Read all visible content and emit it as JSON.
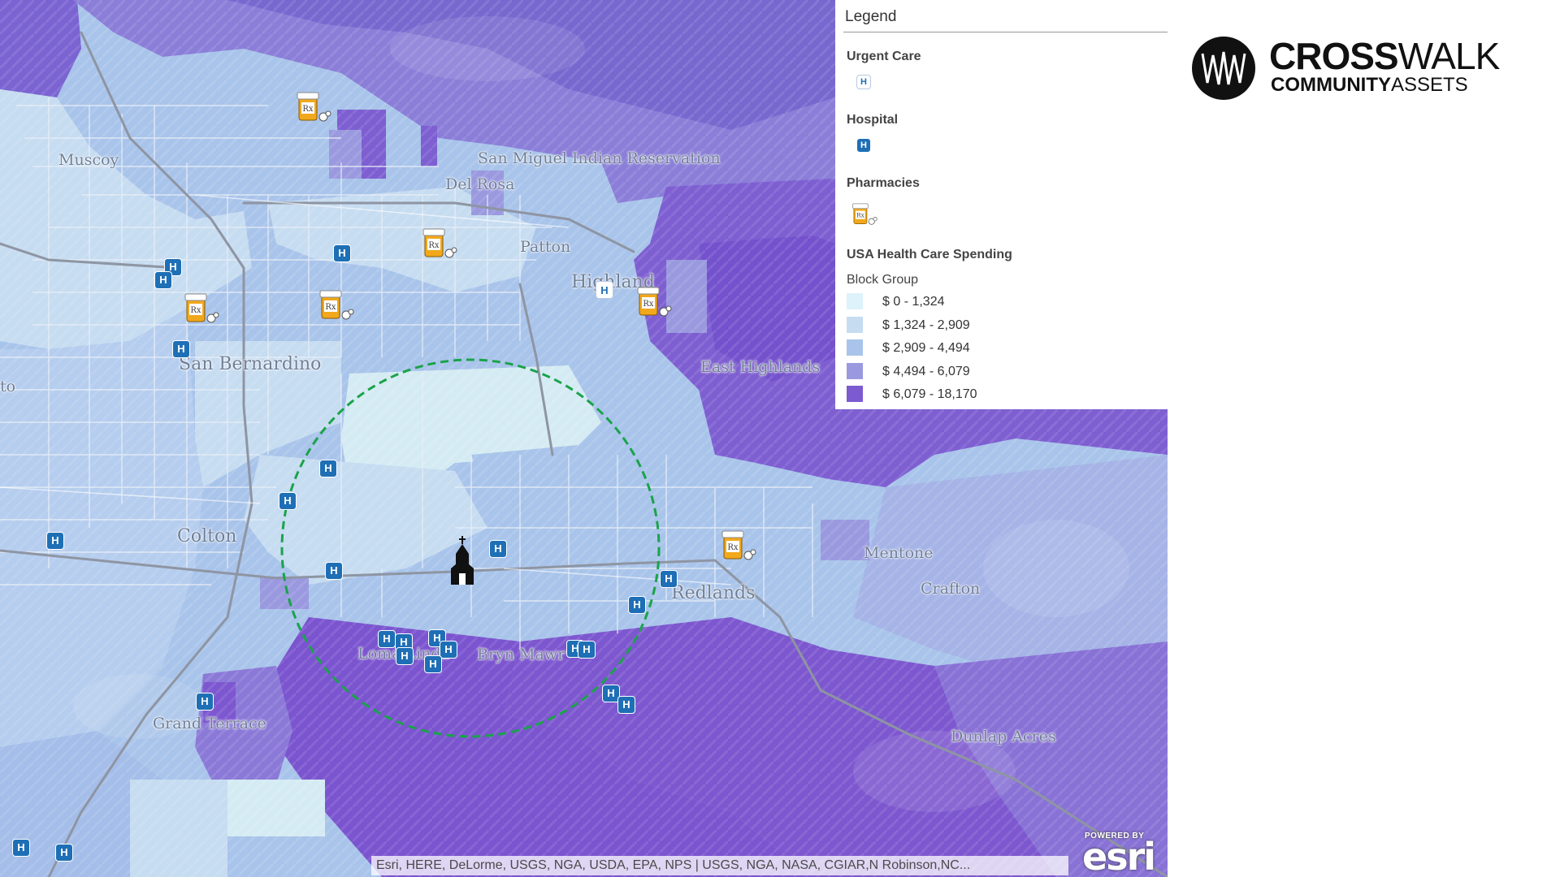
{
  "map": {
    "places": [
      {
        "label": "Muscoy"
      },
      {
        "label": "San Miguel Indian Reservation"
      },
      {
        "label": "Del Rosa"
      },
      {
        "label": "Patton"
      },
      {
        "label": "Highland"
      },
      {
        "label": "San Bernardino"
      },
      {
        "label": "East Highlands"
      },
      {
        "label": "Colton"
      },
      {
        "label": "Mentone"
      },
      {
        "label": "Crafton"
      },
      {
        "label": "Redlands"
      },
      {
        "label": "Loma Linda"
      },
      {
        "label": "Bryn Mawr"
      },
      {
        "label": "Grand Terrace"
      },
      {
        "label": "Dunlap Acres"
      },
      {
        "label": "to"
      }
    ],
    "hospital_glyph": "H",
    "urgent_glyph": "H",
    "attribution": "Esri, HERE, DeLorme, USGS, NGA, USDA, EPA, NPS | USGS, NGA, NASA, CGIAR,N Robinson,NC...",
    "esri_powered": "POWERED BY",
    "esri_name": "esri",
    "radius_color": "#1aa34a",
    "church_icon": "church-icon"
  },
  "legend": {
    "title": "Legend",
    "urgent_care": "Urgent Care",
    "hospital": "Hospital",
    "pharmacies": "Pharmacies",
    "spending_title": "USA Health Care Spending",
    "block_group": "Block Group",
    "classes": [
      {
        "range": "$ 0 - 1,324",
        "color": "#ddf2fa"
      },
      {
        "range": "$ 1,324 - 2,909",
        "color": "#c6dcf1"
      },
      {
        "range": "$ 2,909 - 4,494",
        "color": "#a9c4ea"
      },
      {
        "range": "$ 4,494 - 6,079",
        "color": "#9a99df"
      },
      {
        "range": "$ 6,079 - 18,170",
        "color": "#7c5bd0"
      }
    ]
  },
  "logo": {
    "line1_bold": "CROSS",
    "line1_light": "WALK",
    "line2_bold": "COMMUNITY",
    "line2_light": "ASSETS"
  }
}
